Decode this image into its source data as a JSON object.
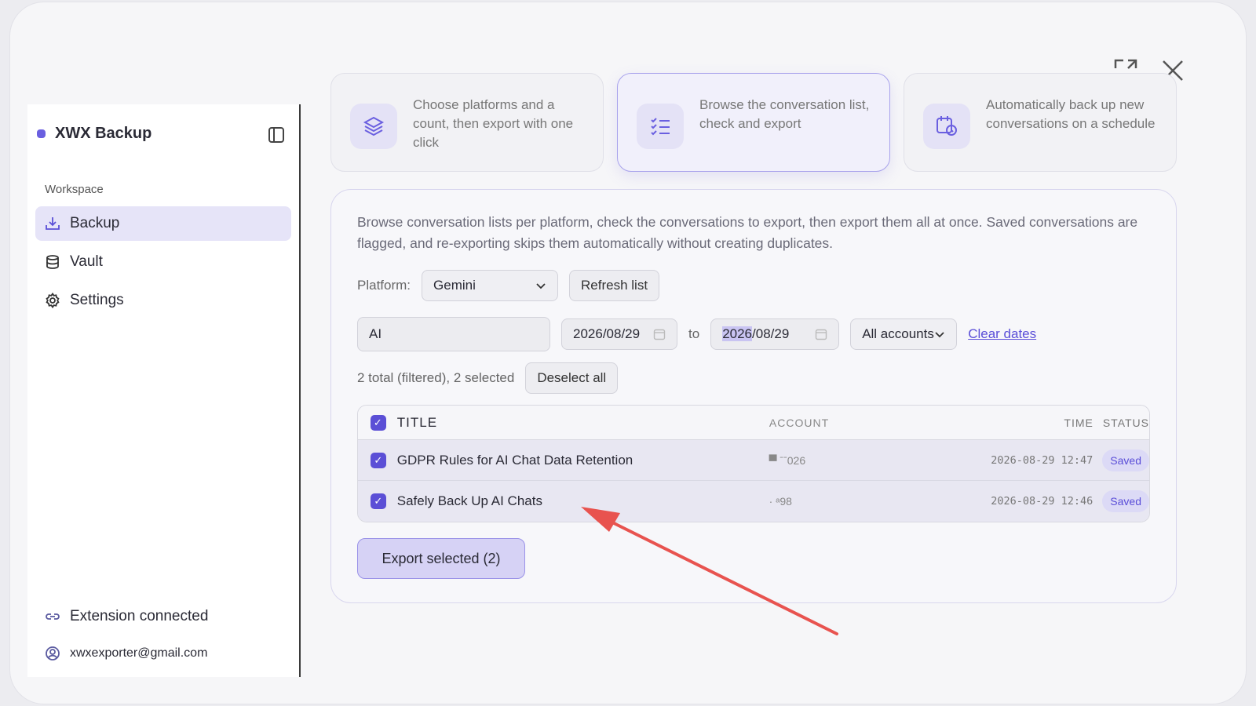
{
  "app": {
    "name": "XWX Backup",
    "workspace_label": "Workspace"
  },
  "nav": [
    {
      "label": "Backup",
      "icon": "download-tray-icon",
      "active": true
    },
    {
      "label": "Vault",
      "icon": "database-icon",
      "active": false
    },
    {
      "label": "Settings",
      "icon": "gear-icon",
      "active": false
    }
  ],
  "footer": {
    "extension_status": "Extension connected",
    "email": "xwxexporter@gmail.com"
  },
  "modes": [
    {
      "desc": "Choose platforms and a count, then export with one click",
      "icon": "layers-icon",
      "active": false
    },
    {
      "desc": "Browse the conversation list, check and export",
      "icon": "checklist-icon",
      "active": true
    },
    {
      "desc": "Automatically back up new conversations on a schedule",
      "icon": "calendar-clock-icon",
      "active": false
    }
  ],
  "panel": {
    "intro": "Browse conversation lists per platform, check the conversations to export, then export them all at once. Saved conversations are flagged, and re-exporting skips them automatically without creating duplicates.",
    "platform_label": "Platform:",
    "platform_value": "Gemini",
    "refresh_label": "Refresh list",
    "search_value": "AI",
    "date_from": "2026/08/29",
    "to_label": "to",
    "date_to_selected": "2026",
    "date_to_rest": "/08/29",
    "accounts_value": "All accounts",
    "clear_dates_label": "Clear dates",
    "count_text": "2 total (filtered), 2 selected",
    "deselect_label": "Deselect all",
    "export_label": "Export selected (2)"
  },
  "table": {
    "headers": {
      "title": "TITLE",
      "account": "ACCOUNT",
      "time": "TIME",
      "status": "STATUS"
    },
    "rows": [
      {
        "title": "GDPR Rules for AI Chat Data Retention",
        "account": "▀ ˉˉ026",
        "time": "2026-08-29 12:47",
        "status": "Saved"
      },
      {
        "title": "Safely Back Up AI Chats",
        "account": "·   ᵃ98",
        "time": "2026-08-29 12:46",
        "status": "Saved"
      }
    ]
  },
  "colors": {
    "accent": "#5b4fd6",
    "annotation_arrow": "#e8534f"
  }
}
